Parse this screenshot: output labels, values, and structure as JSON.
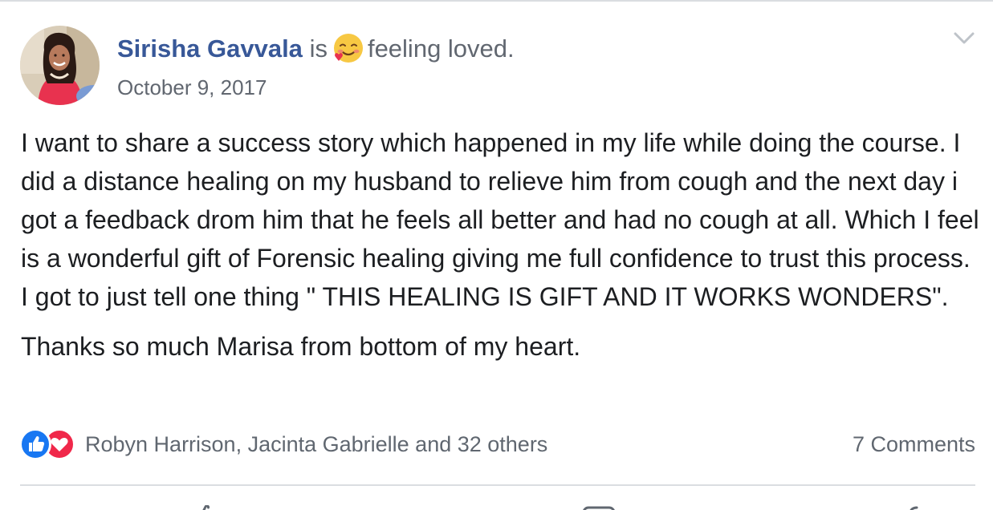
{
  "post": {
    "author": "Sirisha Gavvala",
    "is_text": "is",
    "feeling_text": "feeling loved.",
    "date": "October 9, 2017",
    "paragraphs": [
      "I want to share a success story which happened in my life while doing the course. I did a distance healing on my husband to relieve him from cough and the next day i got a feedback drom him that he feels all better and had no cough at all. Which I feel is a wonderful gift of Forensic healing giving me full confidence to trust this process. I got to just tell one thing \" THIS HEALING IS GIFT AND IT WORKS WONDERS\".",
      "Thanks so much Marisa from bottom of my heart."
    ],
    "reactions_text": "Robyn Harrison, Jacinta Gabrielle and 32 others",
    "comments_text": "7 Comments"
  },
  "icons": {
    "avatar": "profile-photo",
    "feeling": "smiling-face-with-hearts",
    "menu": "chevron-down-icon",
    "reactions": [
      "like-icon",
      "love-icon"
    ]
  },
  "colors": {
    "author_link": "#385898",
    "muted": "#616770",
    "like_blue": "#1877f2",
    "love_red": "#f0284a",
    "divider": "#dadde1"
  }
}
